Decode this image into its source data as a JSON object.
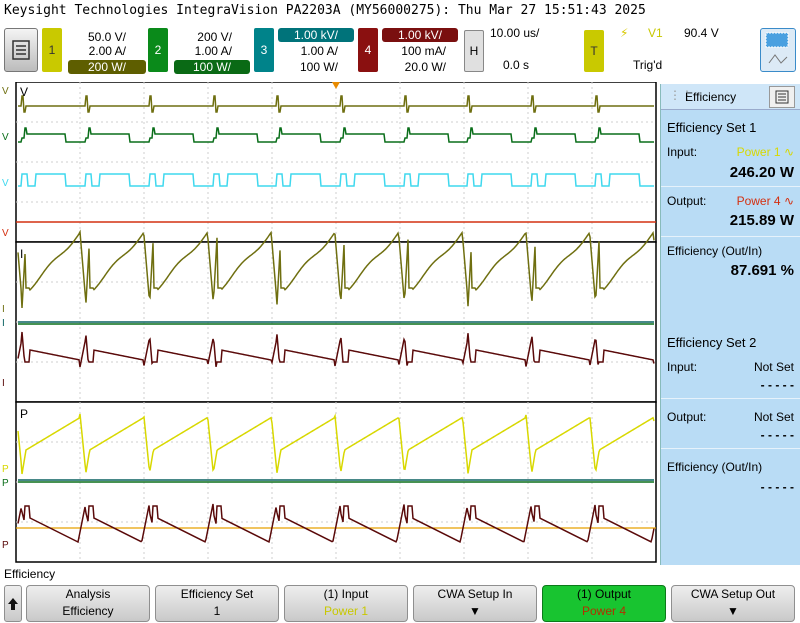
{
  "title": "Keysight Technologies IntegraVision PA2203A (MY56000275): Thu Mar 27 15:51:43 2025",
  "channels": [
    {
      "num": "1",
      "line1": "50.0 V/",
      "line2": "2.00 A/",
      "line3": "200 W/",
      "color": "#9a9a00",
      "pill_color": "#5e5e00"
    },
    {
      "num": "2",
      "line1": "200 V/",
      "line2": "1.00 A/",
      "line3": "100 W/",
      "color": "#0a8a1a",
      "pill_color": "#0a6a15"
    },
    {
      "num": "3",
      "line1": "1.00 kV/",
      "line2": "1.00 A/",
      "line3": "100 W/",
      "color": "#00838a",
      "pill_color": "#00737a"
    },
    {
      "num": "4",
      "line1": "1.00 kV/",
      "line2": "100 mA/",
      "line3": "20.0 W/",
      "color": "#8a1010",
      "pill_color": "#7a0f0f"
    }
  ],
  "horizontal": {
    "label": "H",
    "scale": "10.00 us/",
    "delay": "0.0 s"
  },
  "trigger": {
    "label": "T",
    "source": "V1",
    "level": "90.4 V",
    "status": "Trig'd",
    "slope_symbol": "⚡"
  },
  "plot": {
    "v_label": "V",
    "i_label": "I",
    "p_label": "P",
    "colors": {
      "yellow": "#d8d800",
      "olive": "#6f6f10",
      "green": "#0a6e1a",
      "cyan": "#3fd8ee",
      "red": "#d43010",
      "teal": "#0a6060",
      "maroon": "#5a0a0a",
      "orange": "#e8a000"
    }
  },
  "panel": {
    "title": "Efficiency",
    "set1": {
      "title": "Efficiency Set 1",
      "input_label": "Input:",
      "input_source": "Power 1",
      "input_value": "246.20 W",
      "output_label": "Output:",
      "output_source": "Power 4",
      "output_value": "215.89 W",
      "eff_label": "Efficiency (Out/In)",
      "eff_value": "87.691 %"
    },
    "set2": {
      "title": "Efficiency Set 2",
      "input_label": "Input:",
      "input_value": "Not Set",
      "input_dash": "- - - - -",
      "output_label": "Output:",
      "output_value": "Not Set",
      "output_dash": "- - - - -",
      "eff_label": "Efficiency (Out/In)",
      "eff_dash": "- - - - -"
    }
  },
  "status_text": "Efficiency",
  "softkeys": [
    {
      "l1": "Analysis",
      "l2": "Efficiency",
      "active": false
    },
    {
      "l1": "Efficiency Set",
      "l2": "1",
      "active": false
    },
    {
      "l1": "(1) Input",
      "l2": "Power 1",
      "active": false,
      "l2_color": "#c8c800"
    },
    {
      "l1": "CWA Setup In",
      "l2": "▼",
      "active": false
    },
    {
      "l1": "(1) Output",
      "l2": "Power 4",
      "active": true,
      "l2_color": "#b33000"
    },
    {
      "l1": "CWA Setup Out",
      "l2": "▼",
      "active": false
    }
  ]
}
